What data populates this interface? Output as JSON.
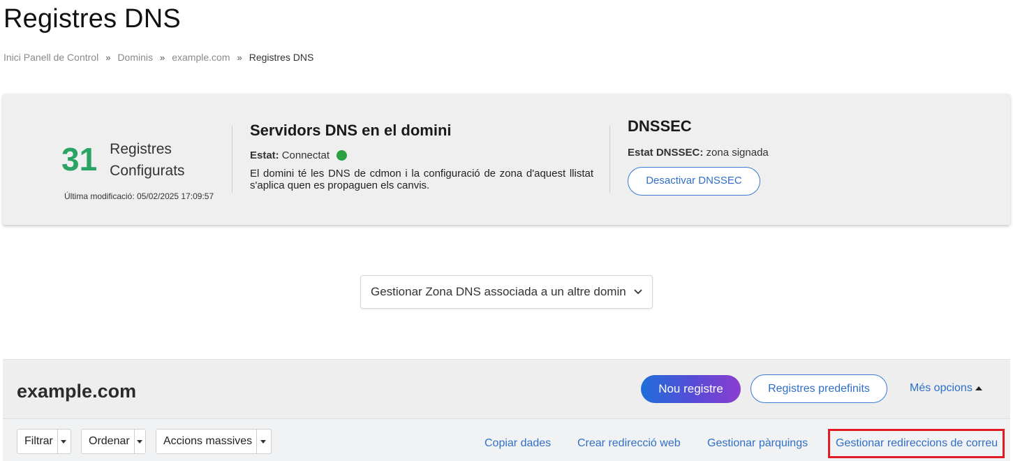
{
  "page": {
    "title": "Registres DNS"
  },
  "breadcrumb": {
    "items": [
      "Inici Panell de Control",
      "Dominis",
      "example.com"
    ],
    "current": "Registres DNS",
    "separator": "»"
  },
  "summary": {
    "count": "31",
    "count_label_line1": "Registres",
    "count_label_line2": "Configurats",
    "last_modified": "Última modificació: 05/02/2025 17:09:57"
  },
  "dns_servers": {
    "title": "Servidors DNS en el domini",
    "status_label": "Estat:",
    "status_value": "Connectat",
    "status_color": "#2aa040",
    "description": "El domini té les DNS de cdmon i la configuració de zona d'aquest llistat s'aplica quen es propaguen els canvis."
  },
  "dnssec": {
    "title": "DNSSEC",
    "status_label": "Estat DNSSEC:",
    "status_value": "zona signada",
    "button_label": "Desactivar DNSSEC"
  },
  "zone_select": {
    "selected": "Gestionar Zona DNS associada a un altre domin",
    "chevron_icon": "chevron-down-icon"
  },
  "domain_panel": {
    "domain": "example.com",
    "new_record": "Nou registre",
    "predefined": "Registres predefinits",
    "more_options": "Més opcions"
  },
  "toolbar": {
    "filter": "Filtrar",
    "sort": "Ordenar",
    "bulk": "Accions massives",
    "links": {
      "copy": "Copiar dades",
      "web_redirect": "Crear redirecció web",
      "parking": "Gestionar pàrquings",
      "mail_redirect": "Gestionar redireccions de correu"
    }
  },
  "colors": {
    "accent": "#2f6fc7",
    "count_green": "#2aa465",
    "highlight": "#e01b24"
  }
}
